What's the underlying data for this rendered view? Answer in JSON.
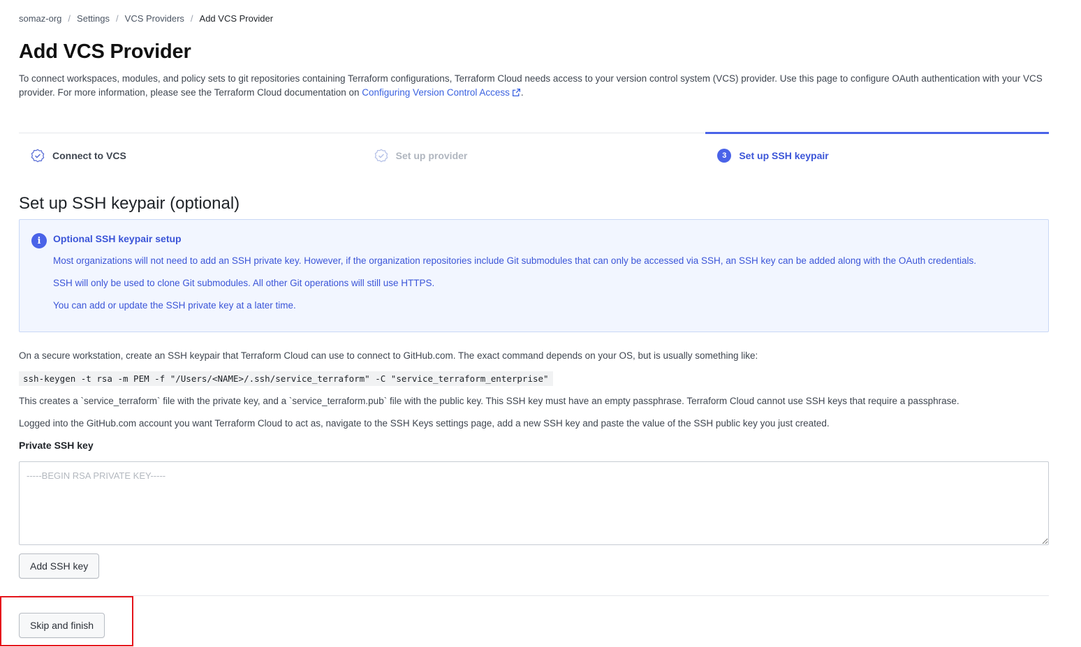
{
  "breadcrumb": {
    "items": [
      "somaz-org",
      "Settings",
      "VCS Providers"
    ],
    "current": "Add VCS Provider",
    "separator": "/"
  },
  "page_title": "Add VCS Provider",
  "intro": {
    "text": "To connect workspaces, modules, and policy sets to git repositories containing Terraform configurations, Terraform Cloud needs access to your version control system (VCS) provider. Use this page to configure OAuth authentication with your VCS provider. For more information, please see the Terraform Cloud documentation on ",
    "link_text": "Configuring Version Control Access",
    "suffix": "."
  },
  "steps": [
    {
      "label": "Connect to VCS",
      "state": "done"
    },
    {
      "label": "Set up provider",
      "state": "done-muted"
    },
    {
      "label": "Set up SSH keypair",
      "state": "active",
      "number": "3"
    }
  ],
  "section_title": "Set up SSH keypair (optional)",
  "info_box": {
    "icon": "i",
    "title": "Optional SSH keypair setup",
    "lines": [
      "Most organizations will not need to add an SSH private key. However, if the organization repositories include Git submodules that can only be accessed via SSH, an SSH key can be added along with the OAuth credentials.",
      "SSH will only be used to clone Git submodules. All other Git operations will still use HTTPS.",
      "You can add or update the SSH private key at a later time."
    ]
  },
  "instructions": {
    "p1": "On a secure workstation, create an SSH keypair that Terraform Cloud can use to connect to GitHub.com. The exact command depends on your OS, but is usually something like:",
    "command": "ssh-keygen -t rsa -m PEM -f \"/Users/<NAME>/.ssh/service_terraform\" -C \"service_terraform_enterprise\"",
    "p2": "This creates a `service_terraform` file with the private key, and a `service_terraform.pub` file with the public key. This SSH key must have an empty passphrase. Terraform Cloud cannot use SSH keys that require a passphrase.",
    "p3": "Logged into the GitHub.com account you want Terraform Cloud to act as, navigate to the SSH Keys settings page, add a new SSH key and paste the value of the SSH public key you just created."
  },
  "private_key_field": {
    "label": "Private SSH key",
    "placeholder": "-----BEGIN RSA PRIVATE KEY-----",
    "value": ""
  },
  "buttons": {
    "add_key": "Add SSH key",
    "skip": "Skip and finish"
  },
  "colors": {
    "accent": "#4a63e8",
    "link": "#3b62e0",
    "info_bg": "#f2f6ff",
    "highlight": "#e5151b"
  }
}
